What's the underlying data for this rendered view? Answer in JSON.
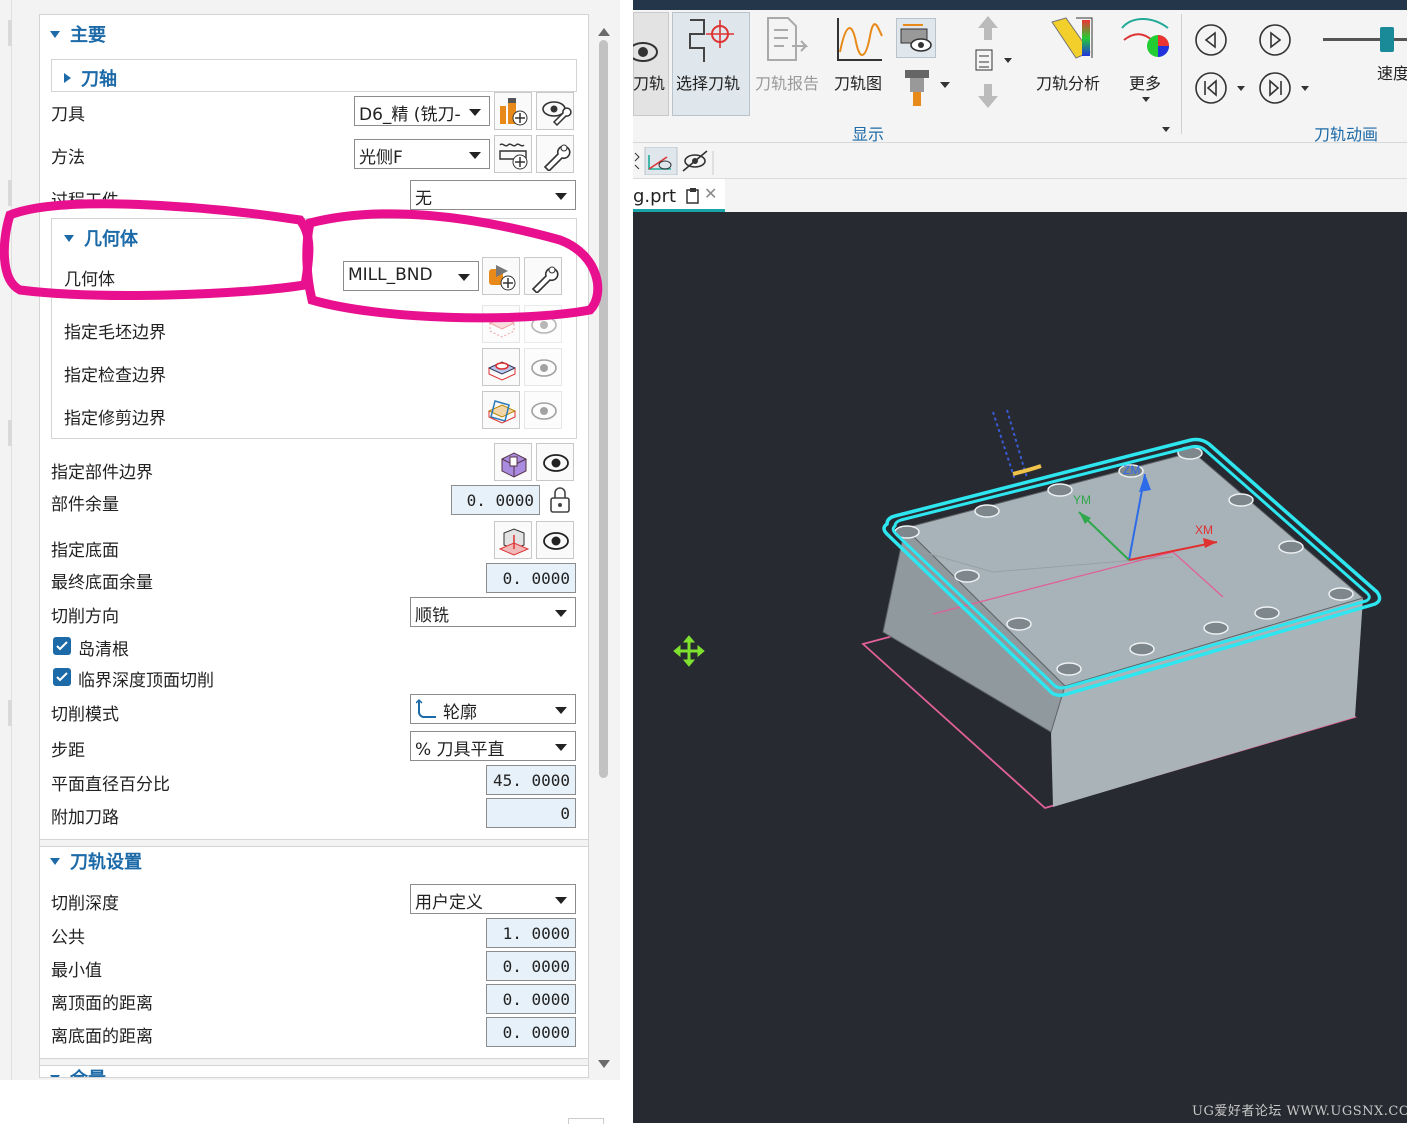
{
  "dialog": {
    "main": {
      "title": "主要",
      "tool_axis": {
        "title": "刀轴"
      },
      "tool": {
        "label": "刀具",
        "value": "D6_精 (铣刀-"
      },
      "method": {
        "label": "方法",
        "value": "光侧F"
      },
      "ipw": {
        "label": "过程工件",
        "value": "无"
      },
      "geometry": {
        "title": "几何体",
        "geometry_label": "几何体",
        "geometry_value": "MILL_BND",
        "blank_boundary": "指定毛坯边界",
        "check_boundary": "指定检查边界",
        "trim_boundary": "指定修剪边界"
      },
      "part_boundary": "指定部件边界",
      "part_stock": {
        "label": "部件余量",
        "value": "0. 0000"
      },
      "floor": "指定底面",
      "final_floor_stock": {
        "label": "最终底面余量",
        "value": "0. 0000"
      },
      "cut_direction": {
        "label": "切削方向",
        "value": "顺铣"
      },
      "island_cleanup": {
        "label": "岛清根",
        "checked": true
      },
      "critical_depth": {
        "label": "临界深度顶面切削",
        "checked": true
      },
      "cut_pattern": {
        "label": "切削模式",
        "value": "轮廓"
      },
      "stepover": {
        "label": "步距",
        "value": "% 刀具平直"
      },
      "flat_diameter_percent": {
        "label": "平面直径百分比",
        "value": "45. 0000"
      },
      "additional_passes": {
        "label": "附加刀路",
        "value": "0"
      }
    },
    "path_settings": {
      "title": "刀轨设置",
      "cut_depth": {
        "label": "切削深度",
        "value": "用户定义"
      },
      "common": {
        "label": "公共",
        "value": "1. 0000"
      },
      "minimum": {
        "label": "最小值",
        "value": "0. 0000"
      },
      "from_top": {
        "label": "离顶面的距离",
        "value": "0. 0000"
      },
      "from_floor": {
        "label": "离底面的距离",
        "value": "0. 0000"
      }
    },
    "next_section": {
      "title": "余量"
    }
  },
  "ribbon": {
    "buttons": {
      "toolpath": "刀轨",
      "select_toolpath": "选择刀轨",
      "toolpath_report": "刀轨报告",
      "toolpath_graph": "刀轨图",
      "toolpath_analysis": "刀轨分析",
      "more": "更多"
    },
    "groups": {
      "display": "显示",
      "animation": "刀轨动画"
    },
    "speed_label": "速度"
  },
  "file_tab": {
    "name": "g.prt"
  },
  "viewport": {
    "axis_labels": {
      "zm": "ZM",
      "ym": "YM",
      "xm": "XM"
    },
    "watermark": "UG爱好者论坛 WWW.UGSNX.COM"
  },
  "colors": {
    "section_title": "#1c6aa8",
    "annotation": "#e8108e",
    "viewport_bg": "#272a30",
    "toolpath": "#2ee6f0",
    "part_body": "#a9b3b8"
  },
  "icons": [
    "new-tool-icon",
    "edit-icon",
    "display-icon",
    "new-method-icon",
    "edit-method-icon",
    "new-geometry-icon",
    "edit-geometry-icon",
    "blank-boundary-icon",
    "check-boundary-icon",
    "trim-boundary-icon",
    "part-boundary-icon",
    "floor-icon",
    "lock-icon",
    "contour-pattern-icon"
  ]
}
